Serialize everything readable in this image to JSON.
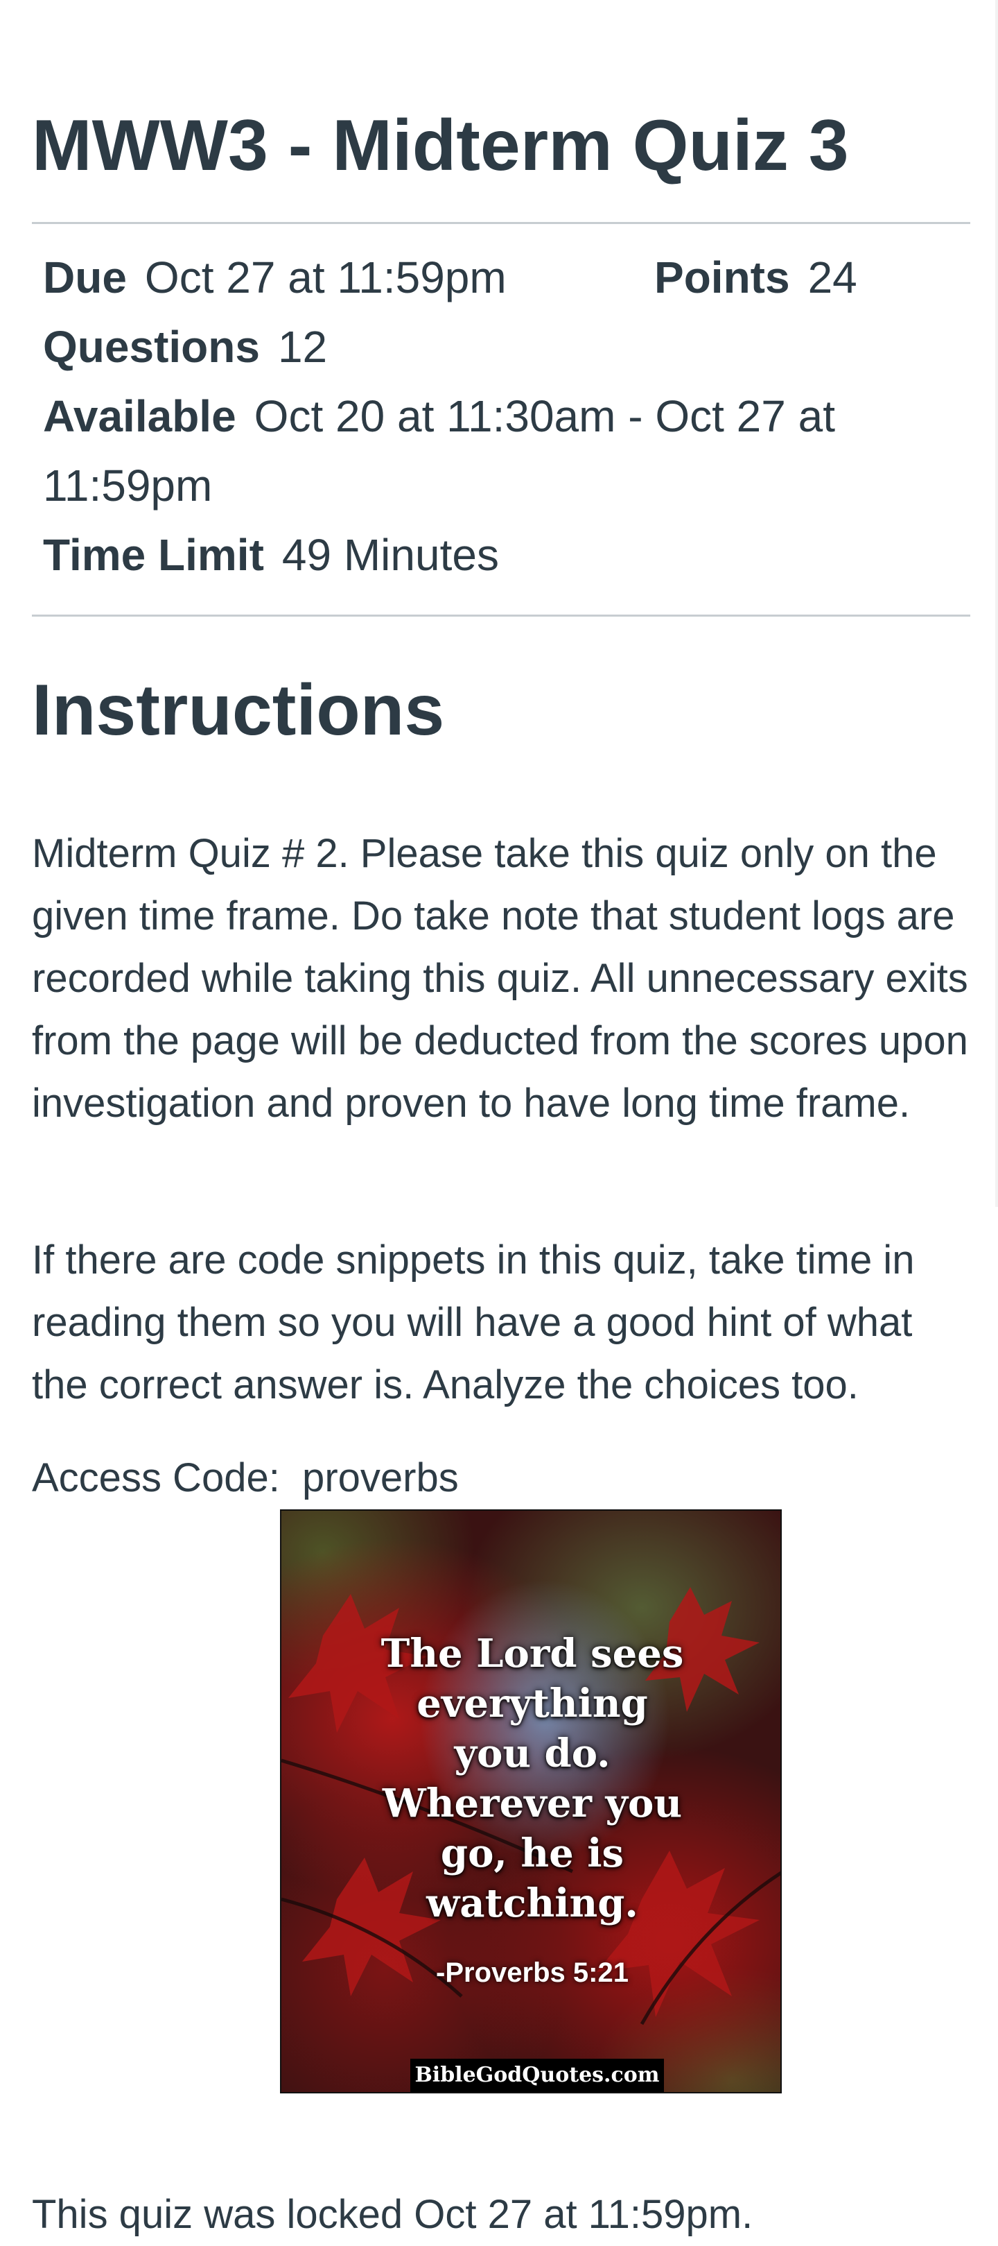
{
  "quiz": {
    "title": "MWW3 - Midterm Quiz 3"
  },
  "details": {
    "due_label": "Due",
    "due_value": "Oct 27 at 11:59pm",
    "points_label": "Points",
    "points_value": "24",
    "questions_label": "Questions",
    "questions_value": "12",
    "available_label": "Available",
    "available_value": "Oct 20 at 11:30am - Oct 27 at 11:59pm",
    "time_limit_label": "Time Limit",
    "time_limit_value": "49 Minutes"
  },
  "instructions": {
    "heading": "Instructions",
    "paragraph_1": "Midterm Quiz # 2. Please take this quiz only on the given time frame. Do take note that student logs are recorded while taking this quiz. All unnecessary exits from the page will be deducted from the scores upon investigation and proven to have long time frame.",
    "paragraph_2": "If there are code snippets in this quiz, take time in reading them so you will have a good hint of what the correct answer is. Analyze the choices too.",
    "access_code": "Access Code:  proverbs"
  },
  "image": {
    "quote_lines": [
      "The Lord sees",
      "everything",
      "you do.",
      "Wherever you",
      "go, he is",
      "watching."
    ],
    "reference": "-Proverbs 5:21",
    "watermark": "BibleGodQuotes.com"
  },
  "status": {
    "locked_text": "This quiz was locked Oct 27 at 11:59pm."
  }
}
